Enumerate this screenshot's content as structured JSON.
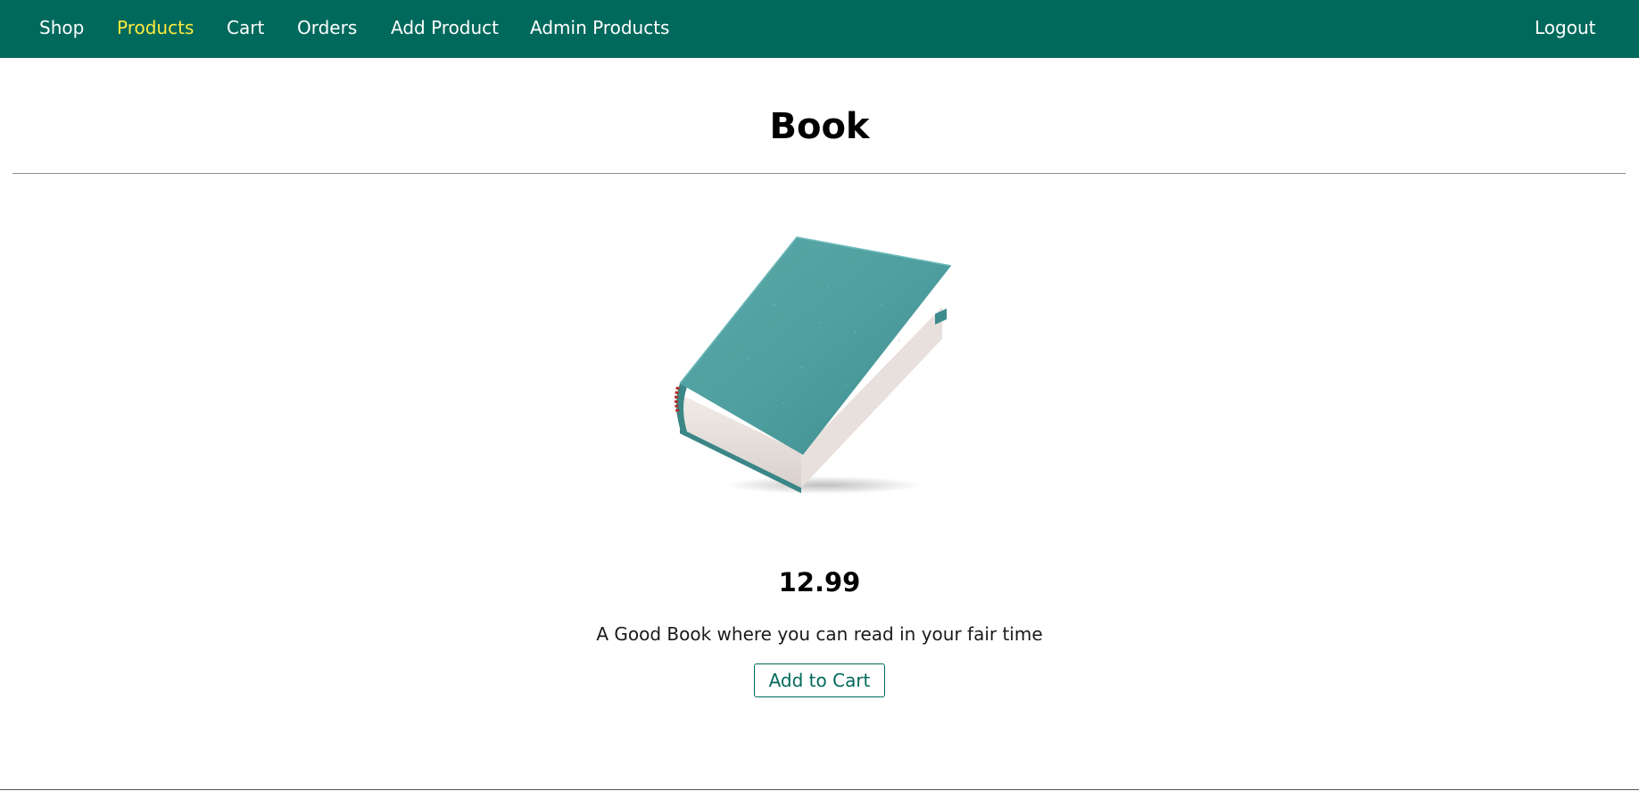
{
  "nav": {
    "items": [
      {
        "label": "Shop"
      },
      {
        "label": "Products"
      },
      {
        "label": "Cart"
      },
      {
        "label": "Orders"
      },
      {
        "label": "Add Product"
      },
      {
        "label": "Admin Products"
      }
    ],
    "active_item": "Products",
    "logout_label": "Logout"
  },
  "product": {
    "title": "Book",
    "image_icon": "book-image",
    "price": "12.99",
    "description": "A Good Book where you can read in your fair time",
    "add_to_cart_label": "Add to Cart"
  },
  "colors": {
    "header_bg": "#00695c",
    "nav_text": "#ffffff",
    "nav_active": "#ffeb3b",
    "accent": "#00695c",
    "book_cover": "#4f9fa0"
  }
}
